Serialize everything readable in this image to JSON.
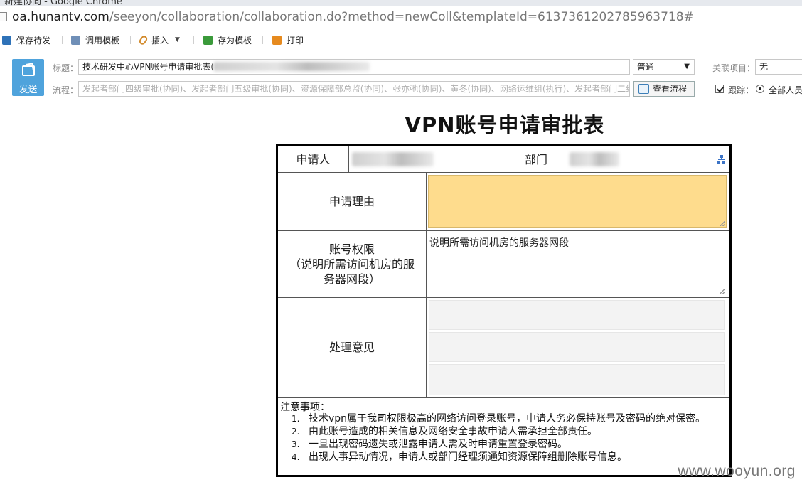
{
  "browser": {
    "window_title_fragment": "新建协同 - Google Chrome",
    "url_host": "oa.hunantv.com",
    "url_path": "/seeyon/collaboration/collaboration.do?method=newColl&templateId=6137361202785963718#"
  },
  "toolbar": {
    "save_draft": "保存待发",
    "use_template": "调用模板",
    "insert": "插入",
    "save_as_template": "存为模板",
    "print": "打印"
  },
  "header": {
    "send_label": "发送",
    "subject_label": "标题：",
    "subject_value": "技术研发中心VPN账号申请审批表(",
    "flow_label": "流程：",
    "flow_value": "发起者部门四级审批(协同)、发起者部门五级审批(协同)、资源保障部总监(协同)、张亦弛(协同)、黄冬(协同)、网络运维组(执行)、发起者部门二级",
    "importance_value": "普通",
    "related_label": "关联项目：",
    "related_value": "无",
    "view_flow_button": "查看流程",
    "track_label": "跟踪：",
    "track_option": "全部人员"
  },
  "form": {
    "title": "VPN账号申请审批表",
    "applicant_label": "申请人",
    "department_label": "部门",
    "reason_label": "申请理由",
    "reason_value": "",
    "permission_label_line1": "账号权限",
    "permission_label_line2": "（说明所需访问机房的服",
    "permission_label_line3": "务器网段）",
    "permission_value": "说明所需访问机房的服务器网段",
    "opinion_label": "处理意见",
    "notes_title": "注意事项：",
    "notes": [
      "技术vpn属于我司权限极高的网络访问登录账号，申请人务必保持账号及密码的绝对保密。",
      "由此账号造成的相关信息及网络安全事故申请人需承担全部责任。",
      "一旦出现密码遗失或泄露申请人需及时申请重置登录密码。",
      "出现人事异动情况，申请人或部门经理须通知资源保障组删除账号信息。"
    ]
  },
  "watermark": "www.wooyun.org",
  "colors": {
    "send_button": "#4fa3dc",
    "reason_field": "#fedc8d"
  },
  "icons": [
    "save-icon",
    "template-icon",
    "attach-icon",
    "save-template-icon",
    "print-icon",
    "send-icon",
    "flow-icon",
    "org-icon"
  ]
}
